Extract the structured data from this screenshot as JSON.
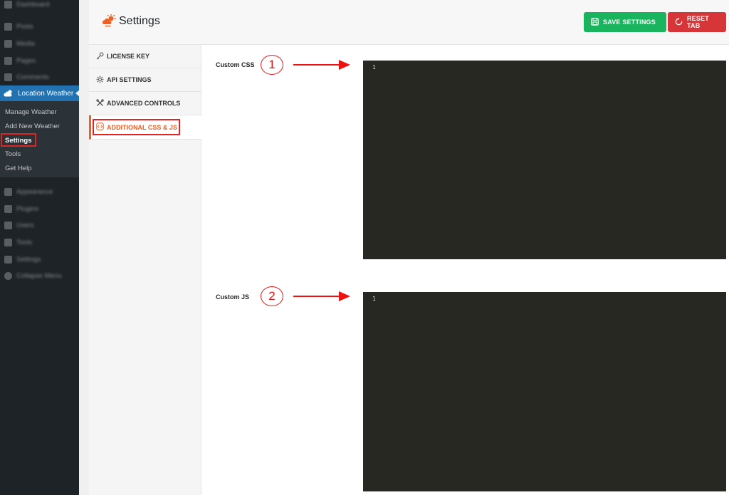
{
  "sidebar": {
    "top_items": [
      "Dashboard",
      "Posts",
      "Media",
      "Pages",
      "Comments"
    ],
    "active_item": "Location Weather",
    "submenu": [
      "Manage Weather",
      "Add New Weather",
      "Settings",
      "Tools",
      "Get Help"
    ],
    "current_submenu": "Settings",
    "bottom_items": [
      "Appearance",
      "Plugins",
      "Users",
      "Tools",
      "Settings",
      "Collapse Menu"
    ]
  },
  "header": {
    "title": "Settings",
    "save_label": "SAVE SETTINGS",
    "reset_label": "RESET TAB",
    "brand_color": "#f05f22",
    "save_color": "#1ab35e",
    "reset_color": "#d63638"
  },
  "tabs": [
    {
      "label": "LICENSE KEY",
      "icon": "key-icon"
    },
    {
      "label": "API SETTINGS",
      "icon": "gear-icon"
    },
    {
      "label": "ADVANCED CONTROLS",
      "icon": "tools-icon"
    },
    {
      "label": "ADDITIONAL CSS & JS",
      "icon": "code-icon",
      "active": true
    }
  ],
  "fields": {
    "css_label": "Custom CSS",
    "js_label": "Custom JS",
    "css_line_number": "1",
    "js_line_number": "1"
  },
  "annotations": {
    "first": "1",
    "second": "2",
    "color": "#ee1111"
  }
}
